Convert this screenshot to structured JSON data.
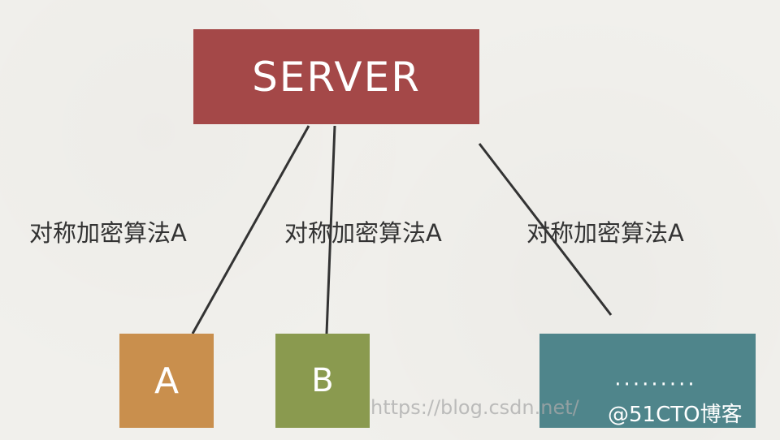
{
  "diagram": {
    "server": {
      "label": "SERVER",
      "color": "#a44848"
    },
    "clients": [
      {
        "label": "A",
        "color": "#c98f4d"
      },
      {
        "label": "B",
        "color": "#8a9a4f"
      },
      {
        "label": "·········",
        "color": "#4f858b"
      }
    ],
    "edge_labels": [
      "对称加密算法A",
      "对称加密算法A",
      "对称加密算法A"
    ]
  },
  "watermark": {
    "url": "https://blog.csdn.net/",
    "badge": "@51CTO博客"
  }
}
